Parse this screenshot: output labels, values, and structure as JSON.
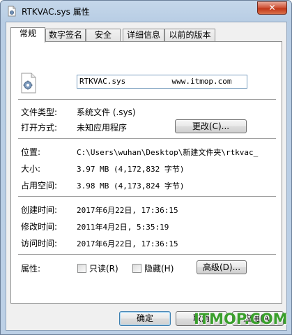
{
  "window": {
    "title": "RTKVAC.sys 属性",
    "close_label": "✕"
  },
  "tabs": [
    {
      "label": "常规",
      "active": true
    },
    {
      "label": "数字签名",
      "active": false
    },
    {
      "label": "安全",
      "active": false
    },
    {
      "label": "详细信息",
      "active": false
    },
    {
      "label": "以前的版本",
      "active": false
    }
  ],
  "general": {
    "filename_value": "RTKVAC.sys          www.itmop.com",
    "file_type_label": "文件类型:",
    "file_type_value": "系统文件 (.sys)",
    "open_with_label": "打开方式:",
    "open_with_value": "未知应用程序",
    "change_button": "更改(C)...",
    "location_label": "位置:",
    "location_value": "C:\\Users\\wuhan\\Desktop\\新建文件夹\\rtkvac_",
    "size_label": "大小:",
    "size_value": "3.97 MB (4,172,832 字节)",
    "size_on_disk_label": "占用空间:",
    "size_on_disk_value": "3.98 MB (4,173,824 字节)",
    "created_label": "创建时间:",
    "created_value": "2017年6月22日, 17:36:15",
    "modified_label": "修改时间:",
    "modified_value": "2011年4月2日, 5:35:19",
    "accessed_label": "访问时间:",
    "accessed_value": "2017年6月22日, 17:36:15",
    "attributes_label": "属性:",
    "readonly_label": "只读(R)",
    "hidden_label": "隐藏(H)",
    "advanced_button": "高级(D)..."
  },
  "footer": {
    "ok_button": "确定",
    "cancel_button": "取消",
    "apply_button": "应用(A)"
  },
  "watermark": "ITMOP.COM"
}
